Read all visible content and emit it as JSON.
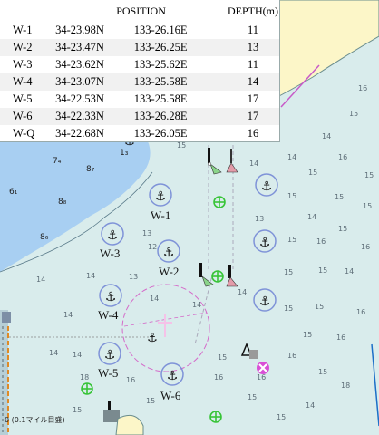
{
  "table": {
    "headers": [
      "POSITION",
      "DEPTH(m)"
    ],
    "rows": [
      {
        "name": "W-1",
        "lat": "34-23.98N",
        "lon": "133-26.16E",
        "depth": "11"
      },
      {
        "name": "W-2",
        "lat": "34-23.47N",
        "lon": "133-26.25E",
        "depth": "13"
      },
      {
        "name": "W-3",
        "lat": "34-23.62N",
        "lon": "133-25.62E",
        "depth": "11"
      },
      {
        "name": "W-4",
        "lat": "34-23.07N",
        "lon": "133-25.58E",
        "depth": "14"
      },
      {
        "name": "W-5",
        "lat": "34-22.53N",
        "lon": "133-25.58E",
        "depth": "17"
      },
      {
        "name": "W-6",
        "lat": "34-22.33N",
        "lon": "133-26.28E",
        "depth": "17"
      },
      {
        "name": "W-Q",
        "lat": "34-22.68N",
        "lon": "133-26.05E",
        "depth": "16"
      }
    ]
  },
  "anchorages": [
    "W-1",
    "W-2",
    "W-3",
    "W-4",
    "W-5",
    "W-6"
  ],
  "depth_soundings": [
    "7₄",
    "8₇",
    "6₁",
    "8₈",
    "8₆",
    "1₃",
    "14",
    "14",
    "14",
    "14",
    "15",
    "15",
    "16",
    "14",
    "15",
    "16",
    "15",
    "15",
    "15",
    "15",
    "15",
    "14",
    "13",
    "12",
    "13",
    "14",
    "14",
    "14",
    "15",
    "16",
    "13",
    "14",
    "16",
    "15",
    "15",
    "14",
    "14",
    "14",
    "15",
    "15",
    "14",
    "14",
    "16",
    "15",
    "16",
    "16",
    "15",
    "16",
    "18",
    "16",
    "15",
    "15",
    "18",
    "16",
    "15",
    "14",
    "15",
    "15"
  ],
  "scale_label": "0 (0.1マイル目盛)",
  "colors": {
    "water": "#d9ecec",
    "land": "#fcf6c8",
    "shallow": "#a8cff2",
    "anchorage_ring": "#7f93d8",
    "restricted_zone": "#d46ac9",
    "green_buoy": "#37c437",
    "magenta_mark": "#d94fd6"
  }
}
